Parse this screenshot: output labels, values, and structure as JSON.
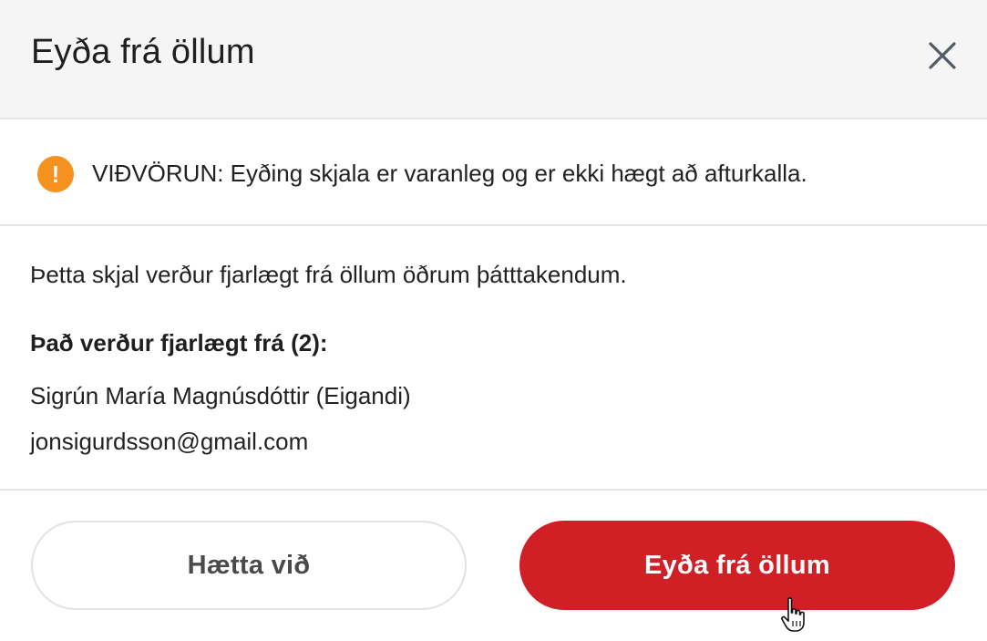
{
  "dialog": {
    "title": "Eyða frá öllum",
    "close_icon": "close-icon"
  },
  "warning": {
    "icon": "exclamation-icon",
    "icon_glyph": "!",
    "text": "VIÐVÖRUN: Eyðing skjala er varanleg og er ekki hægt að afturkalla."
  },
  "body": {
    "description": "Þetta skjal verður fjarlægt frá öllum öðrum þátttakendum.",
    "removed_heading": "Það verður fjarlægt frá (2):",
    "participants": [
      "Sigrún María Magnúsdóttir (Eigandi)",
      "jonsigurdsson@gmail.com"
    ]
  },
  "footer": {
    "cancel_label": "Hætta við",
    "delete_label": "Eyða frá öllum"
  },
  "colors": {
    "danger": "#d11f26",
    "warning": "#f5911e",
    "header_bg": "#f5f5f5"
  }
}
